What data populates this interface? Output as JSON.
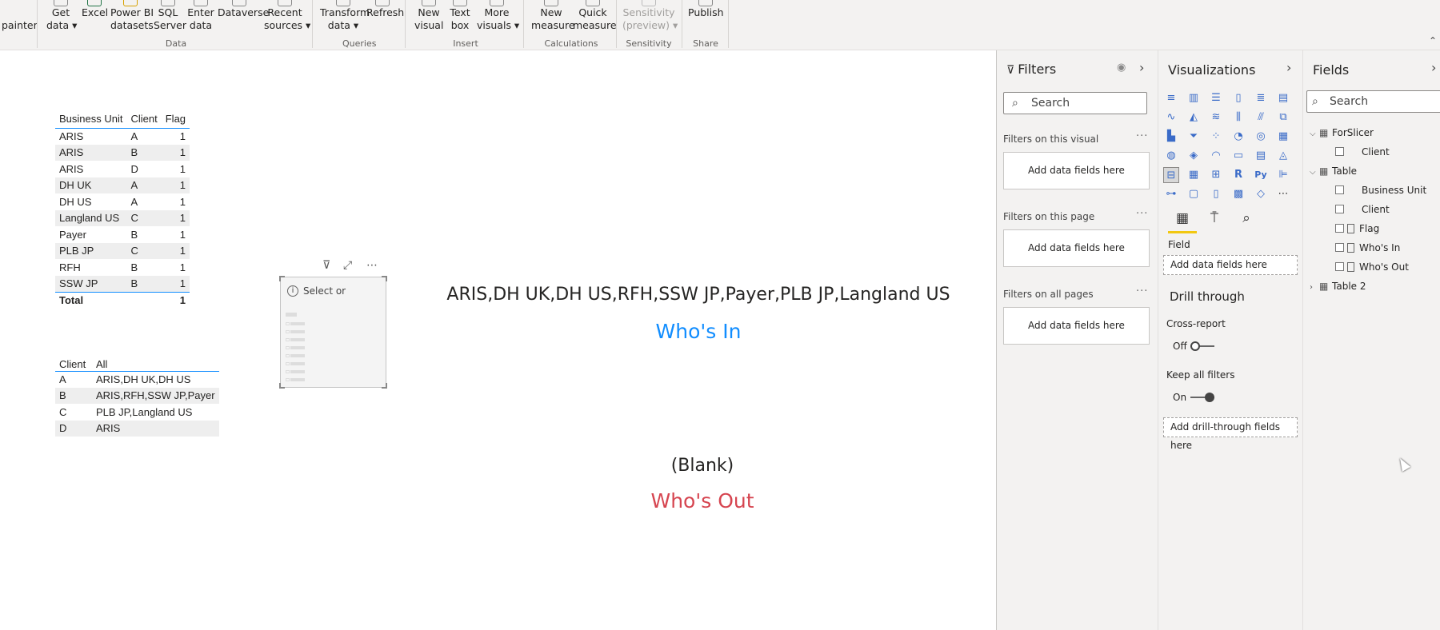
{
  "ribbon": {
    "groups": [
      {
        "label": "Data",
        "buttons": [
          "Get data ▾",
          "Excel",
          "Power BI datasets",
          "SQL Server",
          "Enter data",
          "Dataverse",
          "Recent sources ▾"
        ]
      },
      {
        "label": "Queries",
        "buttons": [
          "Transform data ▾",
          "Refresh"
        ]
      },
      {
        "label": "Insert",
        "buttons": [
          "New visual",
          "Text box",
          "More visuals ▾"
        ]
      },
      {
        "label": "Calculations",
        "buttons": [
          "New measure",
          "Quick measure"
        ]
      },
      {
        "label": "Sensitivity",
        "buttons": [
          "Sensitivity (preview) ▾"
        ]
      },
      {
        "label": "Share",
        "buttons": [
          "Publish"
        ]
      }
    ],
    "format_painter": "painter",
    "get_data_1": "Get",
    "get_data_2": "data ▾",
    "excel": "Excel",
    "pbi_1": "Power BI",
    "pbi_2": "datasets",
    "sql_1": "SQL",
    "sql_2": "Server",
    "enter_1": "Enter",
    "enter_2": "data",
    "dataverse": "Dataverse",
    "recent_1": "Recent",
    "recent_2": "sources ▾",
    "transform_1": "Transform",
    "transform_2": "data ▾",
    "refresh": "Refresh",
    "newvisual_1": "New",
    "newvisual_2": "visual",
    "textbox_1": "Text",
    "textbox_2": "box",
    "morevis_1": "More",
    "morevis_2": "visuals ▾",
    "newmeasure_1": "New",
    "newmeasure_2": "measure",
    "quickmeasure_1": "Quick",
    "quickmeasure_2": "measure",
    "sens_1": "Sensitivity",
    "sens_2": "(preview) ▾",
    "publish": "Publish",
    "label_data": "Data",
    "label_queries": "Queries",
    "label_insert": "Insert",
    "label_calc": "Calculations",
    "label_sens": "Sensitivity",
    "label_share": "Share"
  },
  "table1": {
    "headers": [
      "Business Unit",
      "Client",
      "Flag"
    ],
    "rows": [
      [
        "ARIS",
        "A",
        "1"
      ],
      [
        "ARIS",
        "B",
        "1"
      ],
      [
        "ARIS",
        "D",
        "1"
      ],
      [
        "DH UK",
        "A",
        "1"
      ],
      [
        "DH US",
        "A",
        "1"
      ],
      [
        "Langland US",
        "C",
        "1"
      ],
      [
        "Payer",
        "B",
        "1"
      ],
      [
        "PLB JP",
        "C",
        "1"
      ],
      [
        "RFH",
        "B",
        "1"
      ],
      [
        "SSW JP",
        "B",
        "1"
      ]
    ],
    "total_label": "Total",
    "total_value": "1"
  },
  "table2": {
    "headers": [
      "Client",
      "All"
    ],
    "rows": [
      [
        "A",
        "ARIS,DH UK,DH US"
      ],
      [
        "B",
        "ARIS,RFH,SSW JP,Payer"
      ],
      [
        "C",
        "PLB JP,Langland US"
      ],
      [
        "D",
        "ARIS"
      ]
    ]
  },
  "slicer": {
    "hint": "Select or drag fields to"
  },
  "cards": {
    "in_list": "ARIS,DH UK,DH US,RFH,SSW JP,Payer,PLB JP,Langland US",
    "in_title": "Who's In",
    "out_list": "(Blank)",
    "out_title": "Who's Out"
  },
  "filters": {
    "title": "Filters",
    "search_placeholder": "Search",
    "on_visual": "Filters on this visual",
    "on_page": "Filters on this page",
    "on_all": "Filters on all pages",
    "add_fields": "Add data fields here"
  },
  "visualizations": {
    "title": "Visualizations",
    "field_label": "Field",
    "add_fields": "Add data fields here",
    "drill_through": "Drill through",
    "cross_report": "Cross-report",
    "cross_report_state": "Off",
    "keep_all_filters": "Keep all filters",
    "keep_all_state": "On",
    "add_drill": "Add drill-through fields here",
    "accent_color": "#f2c811"
  },
  "fields": {
    "title": "Fields",
    "search_placeholder": "Search",
    "tree": {
      "forslicer": "ForSlicer",
      "forslicer_client": "Client",
      "table": "Table",
      "business_unit": "Business Unit",
      "table_client": "Client",
      "flag": "Flag",
      "whos_in": "Who's In",
      "whos_out": "Who's Out",
      "table2": "Table 2"
    }
  },
  "colors": {
    "who_in": "#118dff",
    "who_out": "#d64550",
    "table_rule": "#118dff"
  }
}
